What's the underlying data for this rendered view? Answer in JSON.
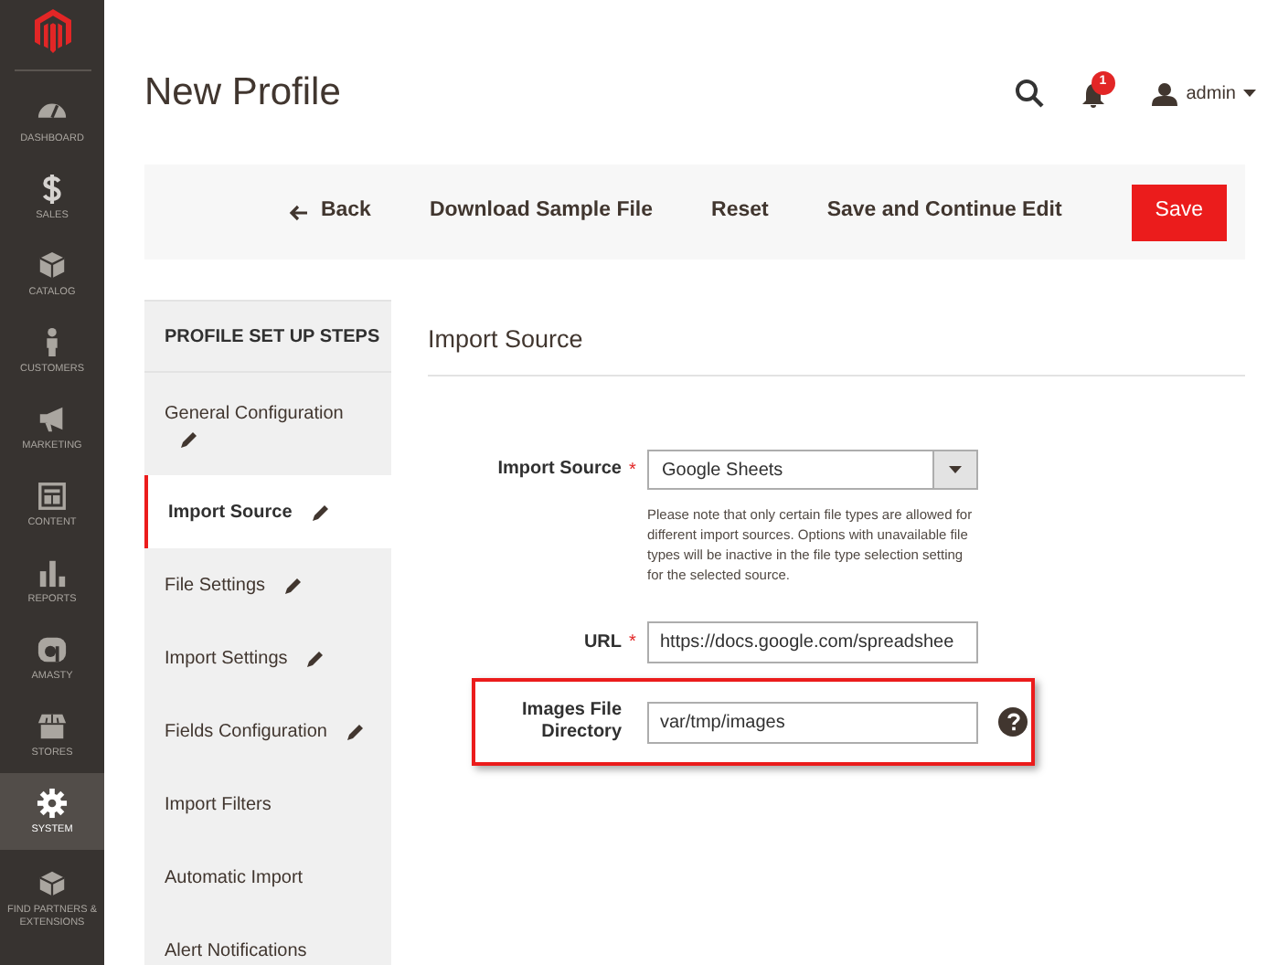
{
  "nav": [
    {
      "label": "DASHBOARD",
      "selected": false
    },
    {
      "label": "SALES",
      "selected": false
    },
    {
      "label": "CATALOG",
      "selected": false
    },
    {
      "label": "CUSTOMERS",
      "selected": false
    },
    {
      "label": "MARKETING",
      "selected": false
    },
    {
      "label": "CONTENT",
      "selected": false
    },
    {
      "label": "REPORTS",
      "selected": false
    },
    {
      "label": "AMASTY",
      "selected": false
    },
    {
      "label": "STORES",
      "selected": false
    },
    {
      "label": "SYSTEM",
      "selected": true
    },
    {
      "label": "FIND PARTNERS & EXTENSIONS",
      "selected": false
    }
  ],
  "page_title": "New Profile",
  "header": {
    "notifications": "1",
    "user": "admin"
  },
  "actions": [
    {
      "label": "Back",
      "kind": "back"
    },
    {
      "label": "Download Sample File",
      "kind": "plain"
    },
    {
      "label": "Reset",
      "kind": "plain"
    },
    {
      "label": "Save and Continue Edit",
      "kind": "plain"
    },
    {
      "label": "Save",
      "kind": "primary"
    }
  ],
  "steps": {
    "title": "PROFILE SET UP STEPS",
    "items": [
      {
        "label": "General Configuration",
        "selected": false,
        "edited": true
      },
      {
        "label": "Import Source",
        "selected": true,
        "edited": true
      },
      {
        "label": "File Settings",
        "selected": false,
        "edited": true
      },
      {
        "label": "Import Settings",
        "selected": false,
        "edited": true
      },
      {
        "label": "Fields Configuration",
        "selected": false,
        "edited": true
      },
      {
        "label": "Import Filters",
        "selected": false,
        "edited": false
      },
      {
        "label": "Automatic Import",
        "selected": false,
        "edited": false
      },
      {
        "label": "Alert Notifications",
        "selected": false,
        "edited": false
      }
    ]
  },
  "section_title": "Import Source",
  "fields": [
    {
      "label": "Import Source",
      "kind": "select",
      "required_mark": "*",
      "value": "Google Sheets",
      "note": "Please note that only certain file types are allowed for different import sources. Options with unavailable file types will be inactive in the file type selection setting for the selected source.",
      "highlighted": false,
      "help": false
    },
    {
      "label": "URL",
      "kind": "text",
      "required_mark": "*",
      "value": "https://docs.google.com/spreadshee",
      "highlighted": false,
      "help": false
    },
    {
      "label": "Images File Directory",
      "kind": "text",
      "value": "var/tmp/images",
      "highlighted": true,
      "help": true
    }
  ]
}
